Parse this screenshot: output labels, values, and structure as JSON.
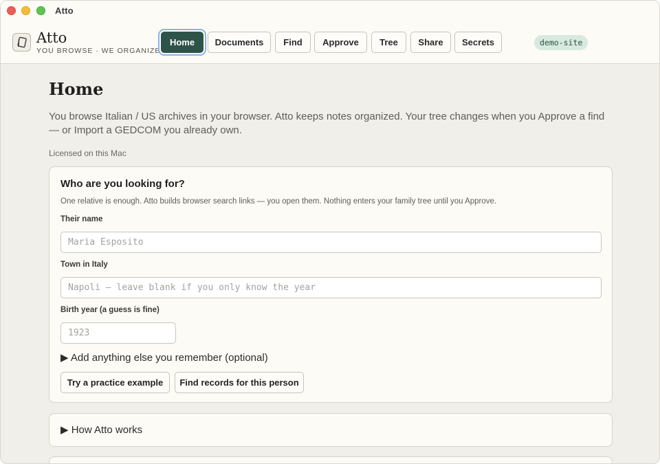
{
  "window": {
    "title": "Atto"
  },
  "brand": {
    "name": "Atto",
    "tagline": "YOU BROWSE · WE ORGANIZE",
    "logo_icon": "notebook-icon"
  },
  "nav": {
    "items": [
      {
        "label": "Home",
        "active": true
      },
      {
        "label": "Documents",
        "active": false
      },
      {
        "label": "Find",
        "active": false
      },
      {
        "label": "Approve",
        "active": false
      },
      {
        "label": "Tree",
        "active": false
      },
      {
        "label": "Share",
        "active": false
      },
      {
        "label": "Secrets",
        "active": false
      }
    ],
    "site_badge": "demo-site"
  },
  "page": {
    "title": "Home",
    "intro": "You browse Italian / US archives in your browser. Atto keeps notes organized. Your tree changes when you Approve a find — or Import a GEDCOM you already own.",
    "license": "Licensed on this Mac"
  },
  "search_card": {
    "title": "Who are you looking for?",
    "subtitle": "One relative is enough. Atto builds browser search links — you open them. Nothing enters your family tree until you Approve.",
    "name_label": "Their name",
    "name_placeholder": "Maria Esposito",
    "name_value": "",
    "town_label": "Town in Italy",
    "town_placeholder": "Napoli — leave blank if you only know the year",
    "town_value": "",
    "year_label": "Birth year (a guess is fine)",
    "year_placeholder": "1923",
    "year_value": "",
    "more_toggle": "▶ Add anything else you remember (optional)",
    "practice_button": "Try a practice example",
    "find_button": "Find records for this person"
  },
  "how_card": {
    "toggle": "▶ How Atto works"
  },
  "colors": {
    "accent": "#2e5449",
    "background": "#f1efe9",
    "card": "#fcfbf6",
    "badge_bg": "#d8eadf"
  }
}
